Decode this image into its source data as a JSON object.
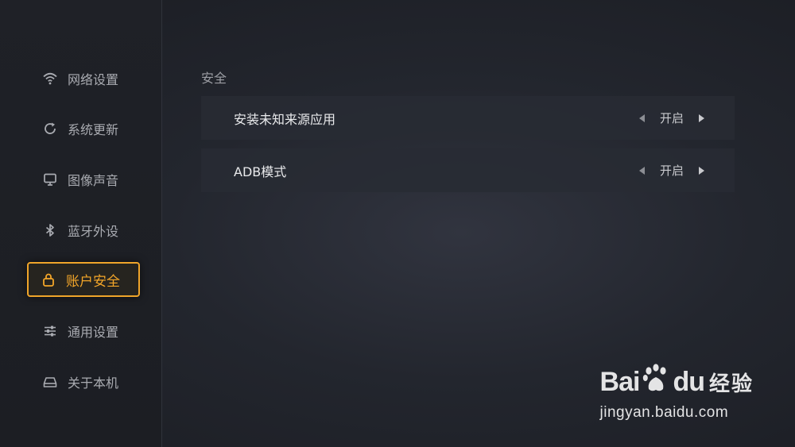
{
  "sidebar": {
    "items": [
      {
        "label": "网络设置",
        "icon": "wifi-icon"
      },
      {
        "label": "系统更新",
        "icon": "refresh-icon"
      },
      {
        "label": "图像声音",
        "icon": "monitor-icon"
      },
      {
        "label": "蓝牙外设",
        "icon": "bluetooth-icon"
      },
      {
        "label": "账户安全",
        "icon": "lock-icon",
        "active": true
      },
      {
        "label": "通用设置",
        "icon": "sliders-icon"
      },
      {
        "label": "关于本机",
        "icon": "device-icon"
      }
    ]
  },
  "main": {
    "section_title": "安全",
    "settings": [
      {
        "label": "安装未知来源应用",
        "value": "开启"
      },
      {
        "label": "ADB模式",
        "value": "开启"
      }
    ]
  },
  "watermark": {
    "brand_latin_left": "Bai",
    "brand_latin_right": "du",
    "brand_cn": "经验",
    "url": "jingyan.baidu.com"
  },
  "colors": {
    "accent": "#f0a52a",
    "background": "#23262e"
  }
}
